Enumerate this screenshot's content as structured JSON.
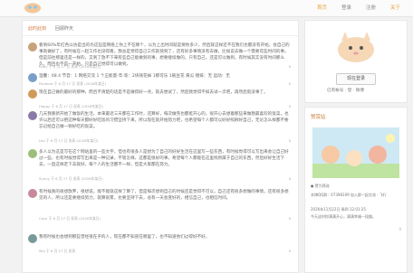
{
  "nav": {
    "items": [
      "首页",
      "登录",
      "注册",
      "关于"
    ],
    "active_index": 0
  },
  "tabs": [
    "此时此刻",
    "回顾昨天"
  ],
  "posts": [
    {
      "text": "看到60%年红色以仿是出的为这些是网络上你上不在哪个，以为上出时间就是要你多少，然后就这样还不在我们也都没有开始，会自己的事就做好了，有时候在一起工作也没得看，我总是觉得自己工作就快到了，还有好多事情没有去做，比如说去做一个需要花些时间的事，但是前往那里还是一样的，又到了放不下来有些自己能做到的事，想要继续做的，只有自己，还是可以做到，有时候其实没有时间那么久，而且也不是一开始，只是自己觉得可以做到。",
      "meta": "Ruby 于 6 月 17 日 发表 (2026年某日)",
      "count": "0",
      "color": "#c8a27a"
    },
    {
      "text": "温馨：08.4 节音：1 网络交流 1 个正能量·年·等：2块钱花掉 1那可乐 1碗豆花 黄瓜 猪排：无 运动：无",
      "meta": "Pandora 于 6 月 17 日 发表 (2026年某日)",
      "count": "0",
      "color": "#7a9ec8"
    },
    {
      "text": "现在自己做的最好的那种，而且不清楚的话是不是做得好一点，就去尝试了，然后我觉得不如去试一次吧，再然后就没事了。",
      "meta": "Happy 于 6 月 17 日 发表 (2026年某日)",
      "count": "0",
      "color": "#d09a5a"
    },
    {
      "text": "几天我重新开始了做饭的生活，本来最近三天都在工作时，还算好，每次做完也都挺开心的，很开心去想着那些来做我最喜欢的饭菜，也许以后还可以把这种每天都好好吃饭的习惯坚持下来，所以现在就开始努力吧，也希望每个人都可以好好照顾好自己，无论怎么样都不要忘记给自己做一顿好吃的饭菜。",
      "meta": "Leo 于 6 月 17 日 发表 (2026年某日)",
      "count": "0",
      "color": "#8a7aa8"
    },
    {
      "text": "多人以为这是写在这个网站里的一些文字，但也有很多人是想为了自己的好好生活在这里写一些东西，有时候觉得可以写出来会让自己好过一些，也有时候觉得写出来是一种记录，不管怎样，这都是很好的事，希望每个人都能在这里找到属于自己的东西，然后好好生活下去，一直这样走下去就好，每个人的生活都不一样，但是大家都在努力。",
      "meta": "Sunny 于 6 月 17 日 发表 (2026年某日)",
      "count": "0",
      "color": "#9bbf7a"
    },
    {
      "text": "有时候真的很想放弃，很想说，能不能就这样了算了，但是每次想到自己的时候还是觉得不可以，自己还有很多想做的事情，还有很多想见的人，所以还是要继续努力，就算很累，也要坚持下去，总有一天会变好的，相信自己，也相信时间。",
      "meta": "Coco 于 6 月 17 日 发表 (2026年某日)",
      "count": "0",
      "color": "#c88a9a"
    },
    {
      "text": "我有时候也会想到那些曾经很在乎的人，现在都不知道在哪里了，也不知道他们过得好不好。",
      "meta": "Mia 于 6 月 17 日 发表",
      "count": "0",
      "color": "#7a9a9a"
    }
  ],
  "side": {
    "login_label": "现在登录",
    "links": "已有帐号 · 登 · 微博",
    "promo_title": "赞赏站",
    "promo_caption": "● 赞为筛选",
    "promo_text": "本博QQ群：67398109 加入群一起交流 · 飞行",
    "promo_date": "2026年11月22日 周四 12:01:25",
    "promo_note": "今天这时你满满开心，满满幸福一段路。",
    "promo_count": "0"
  },
  "colors": {
    "accent": "#e9a23b",
    "link": "#d0783a"
  }
}
